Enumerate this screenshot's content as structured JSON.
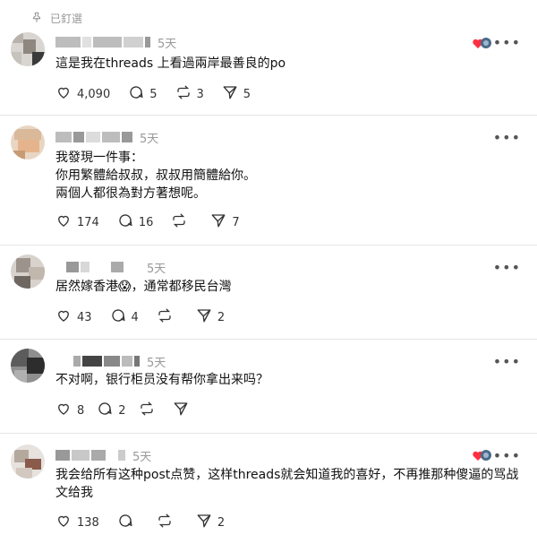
{
  "pinned": {
    "label": "已釘選",
    "icon": "pin-icon"
  },
  "posts": [
    {
      "time": "5天",
      "text": "這是我在threads 上看過兩岸最善良的po",
      "likes": "4,090",
      "replies": "5",
      "reposts": "3",
      "shares": "5",
      "has_liker": true
    },
    {
      "time": "5天",
      "text": "我發現一件事：\n你用繁體給叔叔，叔叔用簡體給你。\n兩個人都很為對方著想呢。",
      "likes": "174",
      "replies": "16",
      "reposts": "",
      "shares": "7",
      "has_liker": false
    },
    {
      "time": "5天",
      "text": "居然嫁香港😱，通常都移民台灣",
      "likes": "43",
      "replies": "4",
      "reposts": "",
      "shares": "2",
      "has_liker": false
    },
    {
      "time": "5天",
      "text": "不对啊，银行柜员没有帮你拿出来吗？",
      "likes": "8",
      "replies": "2",
      "reposts": "",
      "shares": "",
      "has_liker": false
    },
    {
      "time": "5天",
      "text": "我会给所有这种post点赞，这样threads就会知道我的喜好，不再推那种傻逼的骂战文给我",
      "likes": "138",
      "replies": "",
      "reposts": "",
      "shares": "2",
      "has_liker": true
    }
  ],
  "icons": {
    "like": "heart-icon",
    "reply": "comment-icon",
    "repost": "repost-icon",
    "share": "send-icon",
    "more": "more-icon"
  }
}
